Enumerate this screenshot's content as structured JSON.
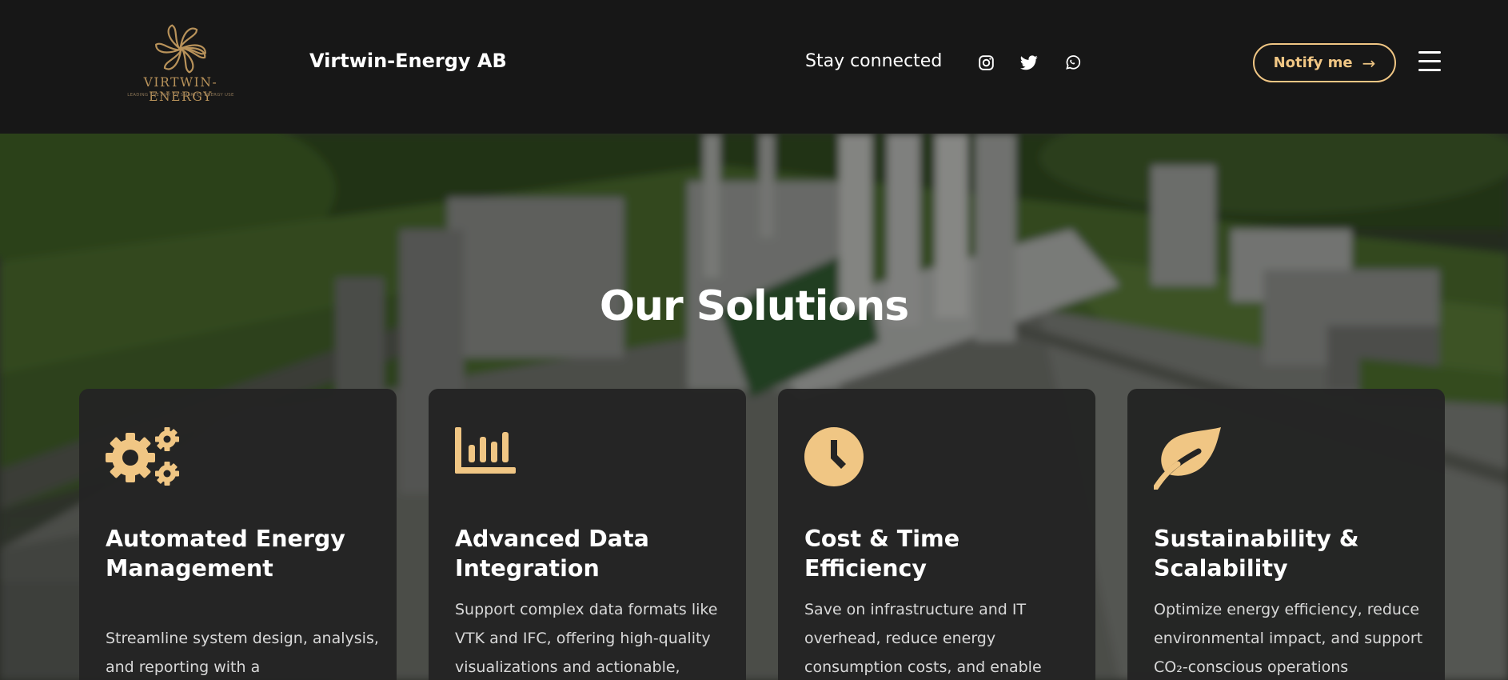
{
  "header": {
    "logo": {
      "wordmark": "VIRTWIN-ENERGY",
      "tagline": "LEADING THE WAY TO SMARTER ENERGY USE"
    },
    "brand": "Virtwin-Energy AB",
    "stay_connected": "Stay connected",
    "social_icons": [
      "instagram-icon",
      "twitter-icon",
      "whatsapp-icon"
    ],
    "notify_label": "Notify me",
    "notify_arrow": "→",
    "menu_icon": "hamburger-menu-icon"
  },
  "colors": {
    "accent": "#f0c684",
    "header_bg": "#171717",
    "card_bg": "#242424"
  },
  "hero": {
    "title": "Our Solutions"
  },
  "cards": [
    {
      "icon": "gears-icon",
      "title": "Automated Energy Management",
      "description": "Streamline system design, analysis, and reporting with a"
    },
    {
      "icon": "bar-chart-icon",
      "title": "Advanced Data Integration",
      "description": "Support complex data formats like VTK and IFC, offering high-quality visualizations and actionable,"
    },
    {
      "icon": "clock-icon",
      "title": "Cost & Time Efficiency",
      "description": "Save on infrastructure and IT overhead, reduce energy consumption costs, and enable"
    },
    {
      "icon": "leaf-icon",
      "title": "Sustainability & Scalability",
      "description": "Optimize energy efficiency, reduce environmental impact, and support CO₂-conscious operations"
    }
  ]
}
